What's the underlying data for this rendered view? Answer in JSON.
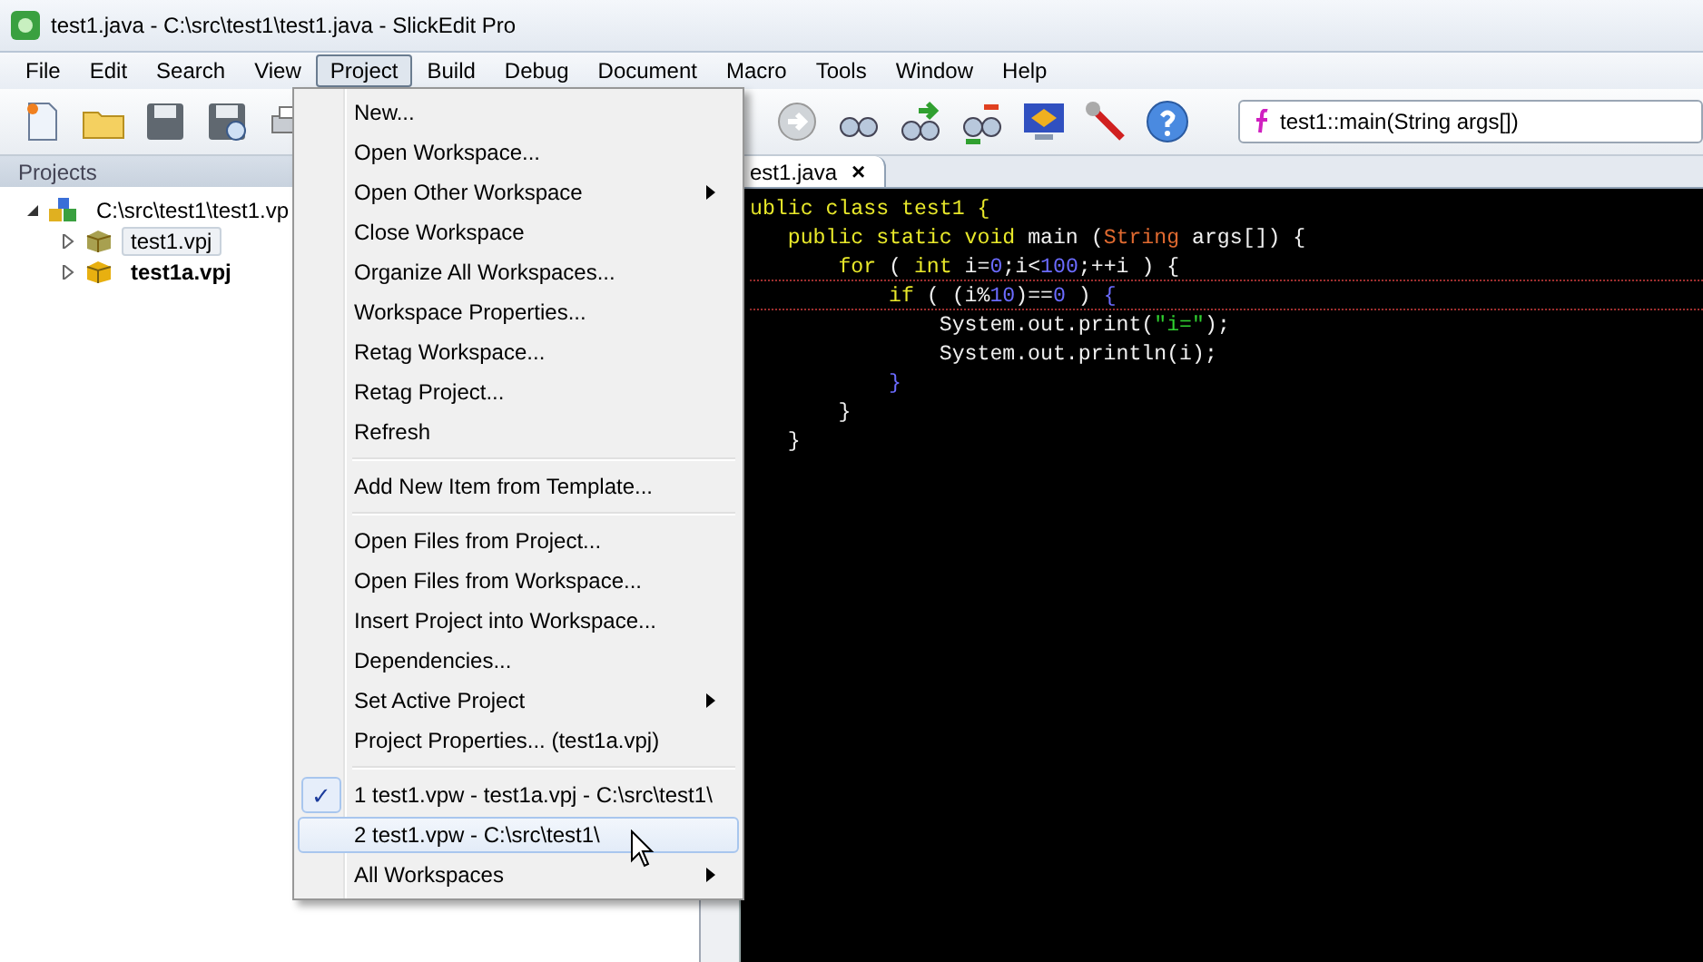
{
  "window": {
    "title": "test1.java - C:\\src\\test1\\test1.java - SlickEdit Pro"
  },
  "menubar": [
    {
      "label": "File",
      "selected": false
    },
    {
      "label": "Edit",
      "selected": false
    },
    {
      "label": "Search",
      "selected": false
    },
    {
      "label": "View",
      "selected": false
    },
    {
      "label": "Project",
      "selected": true
    },
    {
      "label": "Build",
      "selected": false
    },
    {
      "label": "Debug",
      "selected": false
    },
    {
      "label": "Document",
      "selected": false
    },
    {
      "label": "Macro",
      "selected": false
    },
    {
      "label": "Tools",
      "selected": false
    },
    {
      "label": "Window",
      "selected": false
    },
    {
      "label": "Help",
      "selected": false
    }
  ],
  "toolbar": {
    "context": "test1::main(String args[])"
  },
  "projects": {
    "title": "Projects",
    "tree": [
      {
        "label": "C:\\src\\test1\\test1.vp",
        "expanded": true,
        "selected": false,
        "bold": false,
        "children": [
          {
            "label": "test1.vpj",
            "expanded": false,
            "selected": true,
            "bold": false
          },
          {
            "label": "test1a.vpj",
            "expanded": false,
            "selected": false,
            "bold": true
          }
        ]
      }
    ]
  },
  "editor": {
    "tab": "est1.java",
    "tab_close": "×",
    "lines": [
      [
        {
          "kind": "kw",
          "text": "ublic class test1 {"
        }
      ],
      [
        {
          "kind": "kw",
          "text": "   public static void "
        },
        {
          "kind": "plain",
          "text": "main ("
        },
        {
          "kind": "type",
          "text": "String"
        },
        {
          "kind": "plain",
          "text": " args[]) {"
        }
      ],
      [
        {
          "kind": "kw",
          "text": "       for"
        },
        {
          "kind": "plain",
          "text": " ( "
        },
        {
          "kind": "kw",
          "text": "int"
        },
        {
          "kind": "plain",
          "text": " i="
        },
        {
          "kind": "num",
          "text": "0"
        },
        {
          "kind": "plain",
          "text": ";i<"
        },
        {
          "kind": "num",
          "text": "100"
        },
        {
          "kind": "plain",
          "text": ";++i ) {"
        }
      ],
      [
        {
          "kind": "kw",
          "text": "           if"
        },
        {
          "kind": "plain",
          "text": " ( (i%"
        },
        {
          "kind": "num",
          "text": "10"
        },
        {
          "kind": "plain",
          "text": ")=="
        },
        {
          "kind": "num",
          "text": "0"
        },
        {
          "kind": "plain",
          "text": " ) "
        },
        {
          "kind": "num",
          "text": "{"
        }
      ],
      [
        {
          "kind": "plain",
          "text": "               System.out.print("
        },
        {
          "kind": "str",
          "text": "\"i=\""
        },
        {
          "kind": "plain",
          "text": ");"
        }
      ],
      [
        {
          "kind": "plain",
          "text": "               System.out.println(i);"
        }
      ],
      [
        {
          "kind": "num",
          "text": "           }"
        }
      ],
      [
        {
          "kind": "plain",
          "text": "       }"
        }
      ],
      [
        {
          "kind": "plain",
          "text": "   }"
        }
      ]
    ]
  },
  "menu": [
    {
      "kind": "item",
      "label": "New...",
      "selected": false,
      "checked": false
    },
    {
      "kind": "item",
      "label": "Open Workspace...",
      "selected": false,
      "checked": false
    },
    {
      "kind": "submenu",
      "label": "Open Other Workspace",
      "selected": false,
      "checked": false
    },
    {
      "kind": "item",
      "label": "Close Workspace",
      "selected": false,
      "checked": false
    },
    {
      "kind": "item",
      "label": "Organize All Workspaces...",
      "selected": false,
      "checked": false
    },
    {
      "kind": "item",
      "label": "Workspace Properties...",
      "selected": false,
      "checked": false
    },
    {
      "kind": "item",
      "label": "Retag Workspace...",
      "selected": false,
      "checked": false
    },
    {
      "kind": "item",
      "label": "Retag Project...",
      "selected": false,
      "checked": false
    },
    {
      "kind": "item",
      "label": "Refresh",
      "selected": false,
      "checked": false
    },
    {
      "kind": "separator"
    },
    {
      "kind": "item",
      "label": "Add New Item from Template...",
      "selected": false,
      "checked": false
    },
    {
      "kind": "separator"
    },
    {
      "kind": "item",
      "label": "Open Files from Project...",
      "selected": false,
      "checked": false
    },
    {
      "kind": "item",
      "label": "Open Files from Workspace...",
      "selected": false,
      "checked": false
    },
    {
      "kind": "item",
      "label": "Insert Project into Workspace...",
      "selected": false,
      "checked": false
    },
    {
      "kind": "item",
      "label": "Dependencies...",
      "selected": false,
      "checked": false
    },
    {
      "kind": "submenu",
      "label": "Set Active Project",
      "selected": false,
      "checked": false
    },
    {
      "kind": "item",
      "label": "Project Properties... (test1a.vpj)",
      "selected": false,
      "checked": false
    },
    {
      "kind": "separator"
    },
    {
      "kind": "item",
      "label": "1 test1.vpw - test1a.vpj - C:\\src\\test1\\",
      "selected": false,
      "checked": true,
      "mark": "✓"
    },
    {
      "kind": "item",
      "label": "2 test1.vpw - C:\\src\\test1\\",
      "selected": true,
      "checked": false
    },
    {
      "kind": "submenu",
      "label": "All Workspaces",
      "selected": false,
      "checked": false
    }
  ]
}
